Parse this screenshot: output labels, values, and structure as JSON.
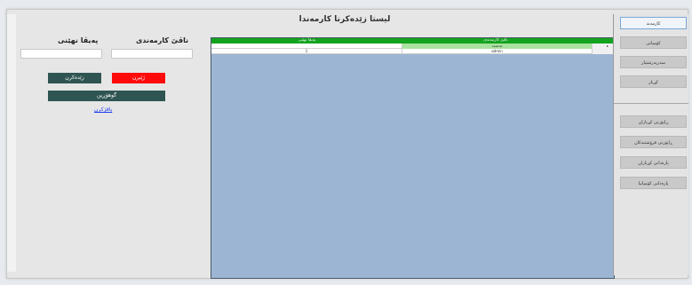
{
  "window": {
    "title": "لیستا زێدەکرنا کارمەندا"
  },
  "form": {
    "name_label": "ناڤێ کارمەندی",
    "password_label": "پەیڤا نهێنی",
    "name_value": "",
    "password_value": "",
    "delete_label": "ژێبرن",
    "save_label": "زێدەکرن",
    "update_label": "گوهۆڕین",
    "link_label": "پاقژکرن"
  },
  "table": {
    "columns": [
      "ناڤێ کارمەندی",
      "پەیڤا نهێنی"
    ],
    "rows": [
      {
        "name": "ئەحمەد",
        "password": ""
      },
      {
        "name": "admin",
        "password": "1"
      }
    ],
    "row_marker": "▸"
  },
  "sidebar": {
    "items": [
      {
        "label": "کارمەند",
        "active": true
      },
      {
        "label": "کۆمپانی",
        "active": false
      },
      {
        "label": "سەرپەرشتیار",
        "active": false
      },
      {
        "label": "کڕیار",
        "active": false
      },
      {
        "label": "ڕاپۆرتی کڕیاران",
        "active": false
      },
      {
        "label": "ڕاپۆرتی فرۆشتنەکان",
        "active": false
      },
      {
        "label": "پارەدانی کڕیاران",
        "active": false
      },
      {
        "label": "پارەدانی کۆمپانیا",
        "active": false
      }
    ]
  }
}
